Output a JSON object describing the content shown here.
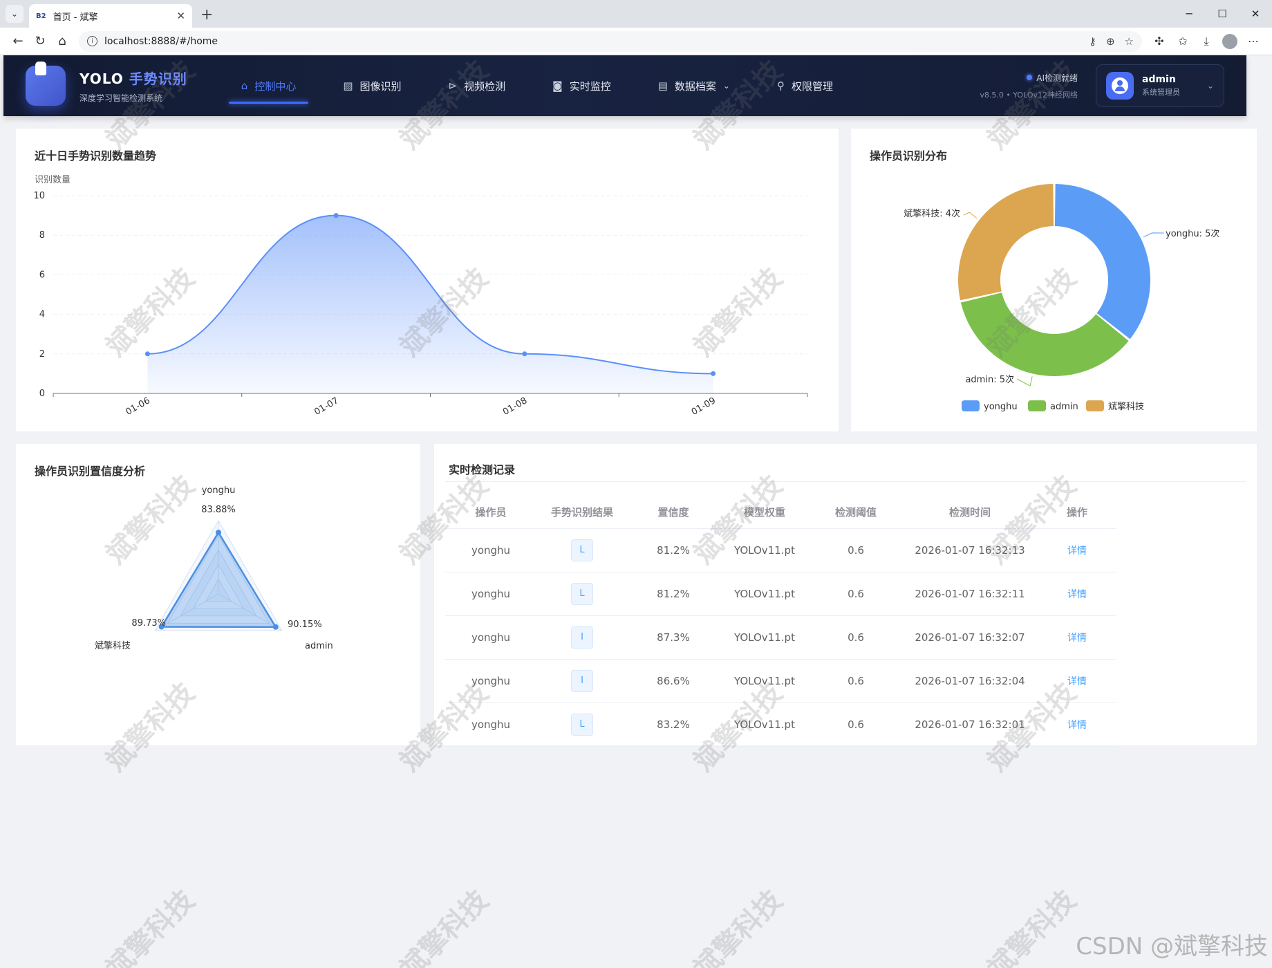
{
  "browser": {
    "tab_title": "首页 - 斌擎",
    "tab_favicon": "B2",
    "url": "localhost:8888/#/home"
  },
  "header": {
    "brand_prefix": "YOLO",
    "brand_accent": "手势识别",
    "brand_subtitle": "深度学习智能检测系统",
    "nav": [
      {
        "label": "控制中心",
        "icon": "home-icon",
        "active": true
      },
      {
        "label": "图像识别",
        "icon": "image-icon"
      },
      {
        "label": "视频检测",
        "icon": "play-icon"
      },
      {
        "label": "实时监控",
        "icon": "camera-icon"
      },
      {
        "label": "数据档案",
        "icon": "document-icon",
        "dropdown": true
      },
      {
        "label": "权限管理",
        "icon": "user-icon"
      }
    ],
    "status": "AI检测就绪",
    "version": "v8.5.0 • YOLOv12神经网络",
    "user_name": "admin",
    "user_role": "系统管理员",
    "accent_color": "#4f7bff"
  },
  "trend": {
    "title": "近十日手势识别数量趋势",
    "ylabel": "识别数量"
  },
  "pie": {
    "title": "操作员识别分布"
  },
  "radar": {
    "title": "操作员识别置信度分析"
  },
  "records": {
    "title": "实时检测记录",
    "columns": [
      "操作员",
      "手势识别结果",
      "置信度",
      "模型权重",
      "检测阈值",
      "检测时间",
      "操作"
    ],
    "rows": [
      {
        "operator": "yonghu",
        "result": "L",
        "confidence": "81.2%",
        "model": "YOLOv11.pt",
        "threshold": "0.6",
        "time": "2026-01-07 16:32:13",
        "action": "详情"
      },
      {
        "operator": "yonghu",
        "result": "L",
        "confidence": "81.2%",
        "model": "YOLOv11.pt",
        "threshold": "0.6",
        "time": "2026-01-07 16:32:11",
        "action": "详情"
      },
      {
        "operator": "yonghu",
        "result": "I",
        "confidence": "87.3%",
        "model": "YOLOv11.pt",
        "threshold": "0.6",
        "time": "2026-01-07 16:32:07",
        "action": "详情"
      },
      {
        "operator": "yonghu",
        "result": "I",
        "confidence": "86.6%",
        "model": "YOLOv11.pt",
        "threshold": "0.6",
        "time": "2026-01-07 16:32:04",
        "action": "详情"
      },
      {
        "operator": "yonghu",
        "result": "L",
        "confidence": "83.2%",
        "model": "YOLOv11.pt",
        "threshold": "0.6",
        "time": "2026-01-07 16:32:01",
        "action": "详情"
      }
    ]
  },
  "watermark_text": "斌擎科技",
  "csdn_watermark": "CSDN @斌擎科技",
  "chart_data": [
    {
      "type": "area",
      "title": "近十日手势识别数量趋势",
      "ylabel": "识别数量",
      "categories": [
        "01-06",
        "01-07",
        "01-08",
        "01-09"
      ],
      "values": [
        2,
        9,
        2,
        1
      ],
      "ylim": [
        0,
        10
      ],
      "yticks": [
        0,
        2,
        4,
        6,
        8,
        10
      ],
      "color": "#5b8ff9",
      "grid": true
    },
    {
      "type": "pie",
      "title": "操作员识别分布",
      "donut": true,
      "labels": [
        "yonghu",
        "admin",
        "斌擎科技"
      ],
      "values": [
        5,
        5,
        4
      ],
      "label_texts": [
        "yonghu: 5次",
        "admin: 5次",
        "斌擎科技: 4次"
      ],
      "colors": [
        "#5b9cf6",
        "#7cc04b",
        "#dba64f"
      ],
      "legend": "bottom"
    },
    {
      "type": "radar",
      "title": "操作员识别置信度分析",
      "indicators": [
        "yonghu",
        "admin",
        "斌擎科技"
      ],
      "values": [
        83.88,
        90.15,
        89.73
      ],
      "value_labels": [
        "83.88%",
        "90.15%",
        "89.73%"
      ],
      "max": 100,
      "color": "#4a90e2"
    }
  ]
}
